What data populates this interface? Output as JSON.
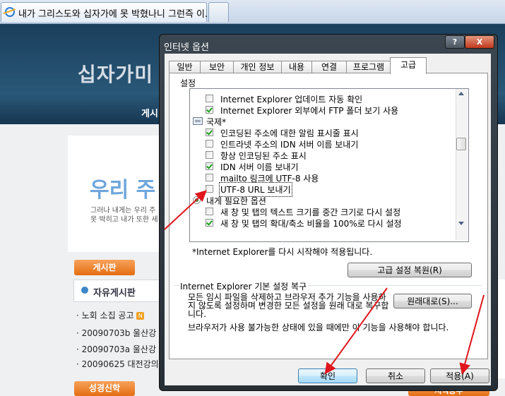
{
  "browser": {
    "tab_title": "내가 그리스도와 십자가에 못 박혔나니 그런즉 이..."
  },
  "website": {
    "logo": "십자가미",
    "nav": "게시",
    "banner_big": "우리 주 이",
    "banner_line1": "그러나 내게는  우리 주",
    "banner_line2": "못 박히고 내가 또한 세",
    "board_button": "게시판",
    "board_title": "자유게시판",
    "board_items": [
      "노회 소집 공고",
      "20090703b 울산강",
      "20090703a 울산강",
      "20090625 대전강의"
    ],
    "new_badge": "N",
    "second_button": "성경신학",
    "right_button": "지식공부"
  },
  "dialog": {
    "title": "인터넷 옵션",
    "help_label": "?",
    "close_label": "X",
    "tabs": [
      "일반",
      "보안",
      "개인 정보",
      "내용",
      "연결",
      "프로그램",
      "고급"
    ],
    "active_tab": "고급",
    "settings_label": "설정",
    "settings": [
      {
        "type": "checkbox",
        "checked": false,
        "label": "Internet Explorer 업데이트 자동 확인"
      },
      {
        "type": "checkbox",
        "checked": true,
        "label": "Internet Explorer 외부에서 FTP 폴더 보기 사용"
      },
      {
        "type": "group",
        "label": "국제*"
      },
      {
        "type": "checkbox",
        "checked": true,
        "label": "인코딩된 주소에 대한 알림 표시줄 표시"
      },
      {
        "type": "checkbox",
        "checked": false,
        "label": "인트라넷 주소의 IDN 서버 이름 보내기"
      },
      {
        "type": "checkbox",
        "checked": false,
        "label": "항상 인코딩된 주소 표시"
      },
      {
        "type": "checkbox",
        "checked": true,
        "label": "IDN 서버 이름 보내기"
      },
      {
        "type": "checkbox",
        "checked": false,
        "label": "mailto 링크에 UTF-8 사용"
      },
      {
        "type": "checkbox",
        "checked": false,
        "label": "UTF-8 URL 보내기",
        "focused": true
      },
      {
        "type": "group",
        "label": "내게 필요한 옵션"
      },
      {
        "type": "checkbox",
        "checked": false,
        "label": "새 창 및 탭의 텍스트 크기를 중간 크기로 다시 설정"
      },
      {
        "type": "checkbox",
        "checked": true,
        "label": "새 창 및 탭의 확대/축소 비율을 100%로 다시 설정"
      }
    ],
    "restart_note": "*Internet Explorer를 다시 시작해야 적용됩니다.",
    "restore_advanced_button": "고급 설정 복원(R)",
    "reset_group_label": "Internet Explorer 기본 설정 복구",
    "reset_desc_1": "모든 임시 파일을 삭제하고 브라우저 추가 기능을 사용하지 않도록 설정하며 변경한 모든 설정을 원래 대로 복구합니다.",
    "reset_desc_2": "브라우저가 사용 불가능한 상태에 있을 때에만 이 기능을 사용해야 합니다.",
    "reset_button": "원래대로(S)...",
    "ok_button": "확인",
    "cancel_button": "취소",
    "apply_button": "적용(A)"
  },
  "annotations": {
    "arrow_color": "#e0161c"
  }
}
